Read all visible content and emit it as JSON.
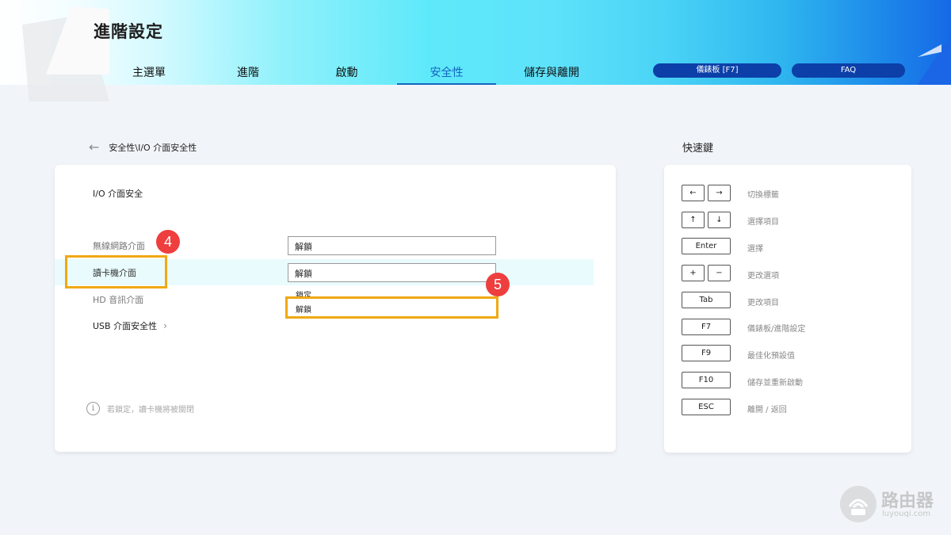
{
  "header": {
    "title": "進階設定",
    "tabs": [
      {
        "label": "主選單"
      },
      {
        "label": "進階"
      },
      {
        "label": "啟動"
      },
      {
        "label": "安全性"
      },
      {
        "label": "儲存與離開"
      }
    ],
    "active_tab": "安全性",
    "dashboard_button": "儀錶板 [F7]",
    "faq_button": "FAQ"
  },
  "breadcrumb": {
    "path": "安全性\\I/O 介面安全性"
  },
  "main": {
    "section_title": "I/O 介面安全",
    "rows": [
      {
        "label": "無線網路介面",
        "value": "解鎖"
      },
      {
        "label": "讀卡機介面",
        "value": "解鎖"
      },
      {
        "label": "HD 音訊介面"
      }
    ],
    "dropdown_options": [
      "鎖定",
      "解鎖"
    ],
    "usb_link": "USB 介面安全性",
    "info_text": "若鎖定，讀卡機將被關閉"
  },
  "annotations": {
    "step4": "4",
    "step5": "5"
  },
  "shortcuts": {
    "title": "快速鍵",
    "items": [
      {
        "keys": [
          "←",
          "→"
        ],
        "desc": "切換標籤"
      },
      {
        "keys": [
          "↑",
          "↓"
        ],
        "desc": "選擇項目"
      },
      {
        "keys": [
          "Enter"
        ],
        "desc": "選擇"
      },
      {
        "keys": [
          "+",
          "−"
        ],
        "desc": "更改選項"
      },
      {
        "keys": [
          "Tab"
        ],
        "desc": "更改項目"
      },
      {
        "keys": [
          "F7"
        ],
        "desc": "儀錶板/進階設定"
      },
      {
        "keys": [
          "F9"
        ],
        "desc": "最佳化預設值"
      },
      {
        "keys": [
          "F10"
        ],
        "desc": "儲存並重新啟動"
      },
      {
        "keys": [
          "ESC"
        ],
        "desc": "離開 / 返回"
      }
    ]
  },
  "watermark": {
    "brand": "路由器",
    "sub": "luyouqi.com"
  },
  "colors": {
    "accent": "#1565c0",
    "highlight": "#f0a812",
    "badge": "#ee3e3e",
    "row_highlight": "#e9fbfd"
  }
}
